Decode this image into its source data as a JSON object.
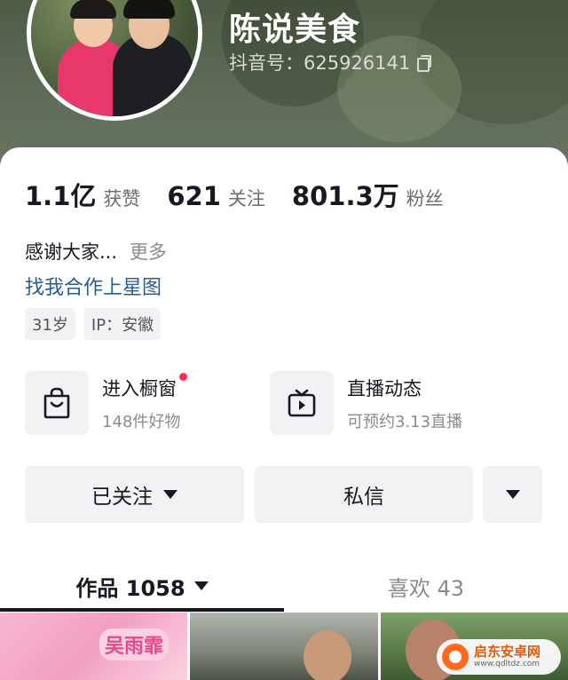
{
  "profile": {
    "nickname": "陈说美食",
    "douyin_id": "抖音号：625926141"
  },
  "stats": [
    {
      "num": "1.1亿",
      "label": "获赞"
    },
    {
      "num": "621",
      "label": "关注"
    },
    {
      "num": "801.3万",
      "label": "粉丝"
    }
  ],
  "bio": {
    "text": "感谢大家...",
    "more": "更多",
    "link": "找我合作上星图"
  },
  "tags": [
    "31岁",
    "IP：安徽"
  ],
  "features": {
    "shop": {
      "title": "进入橱窗",
      "sub": "148件好物"
    },
    "live": {
      "title": "直播动态",
      "sub": "可预约3.13直播"
    }
  },
  "buttons": {
    "followed": "已关注",
    "message": "私信"
  },
  "tabs": {
    "works": "作品 1058",
    "likes": "喜欢 43"
  },
  "thumbnails": {
    "first_caption": "吴雨霏"
  },
  "watermark": {
    "title": "启东安卓网",
    "url": "www.qdltdz.com"
  },
  "colors": {
    "accent_red": "#fe2c55",
    "link_blue": "#2a5d8f"
  }
}
